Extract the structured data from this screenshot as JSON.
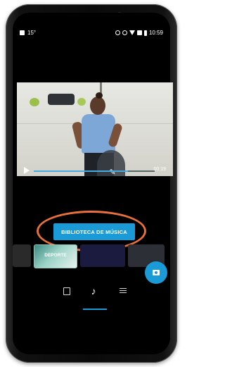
{
  "status_bar": {
    "left_text": "15°",
    "time": "10:59"
  },
  "player": {
    "timecode": "00:19",
    "progress": 0.78
  },
  "music_library_button": {
    "label": "BIBLIOTECA DE MÚSICA"
  },
  "music_strip": {
    "items": [
      {
        "label": ""
      },
      {
        "label": "DEPORTE"
      },
      {
        "label": ""
      },
      {
        "label": ""
      }
    ]
  },
  "bottom_nav": {
    "active_tab": "music",
    "underline_color": "#1a9ad6"
  },
  "colors": {
    "accent": "#1a9ad6",
    "annotation": "#e8703a"
  }
}
